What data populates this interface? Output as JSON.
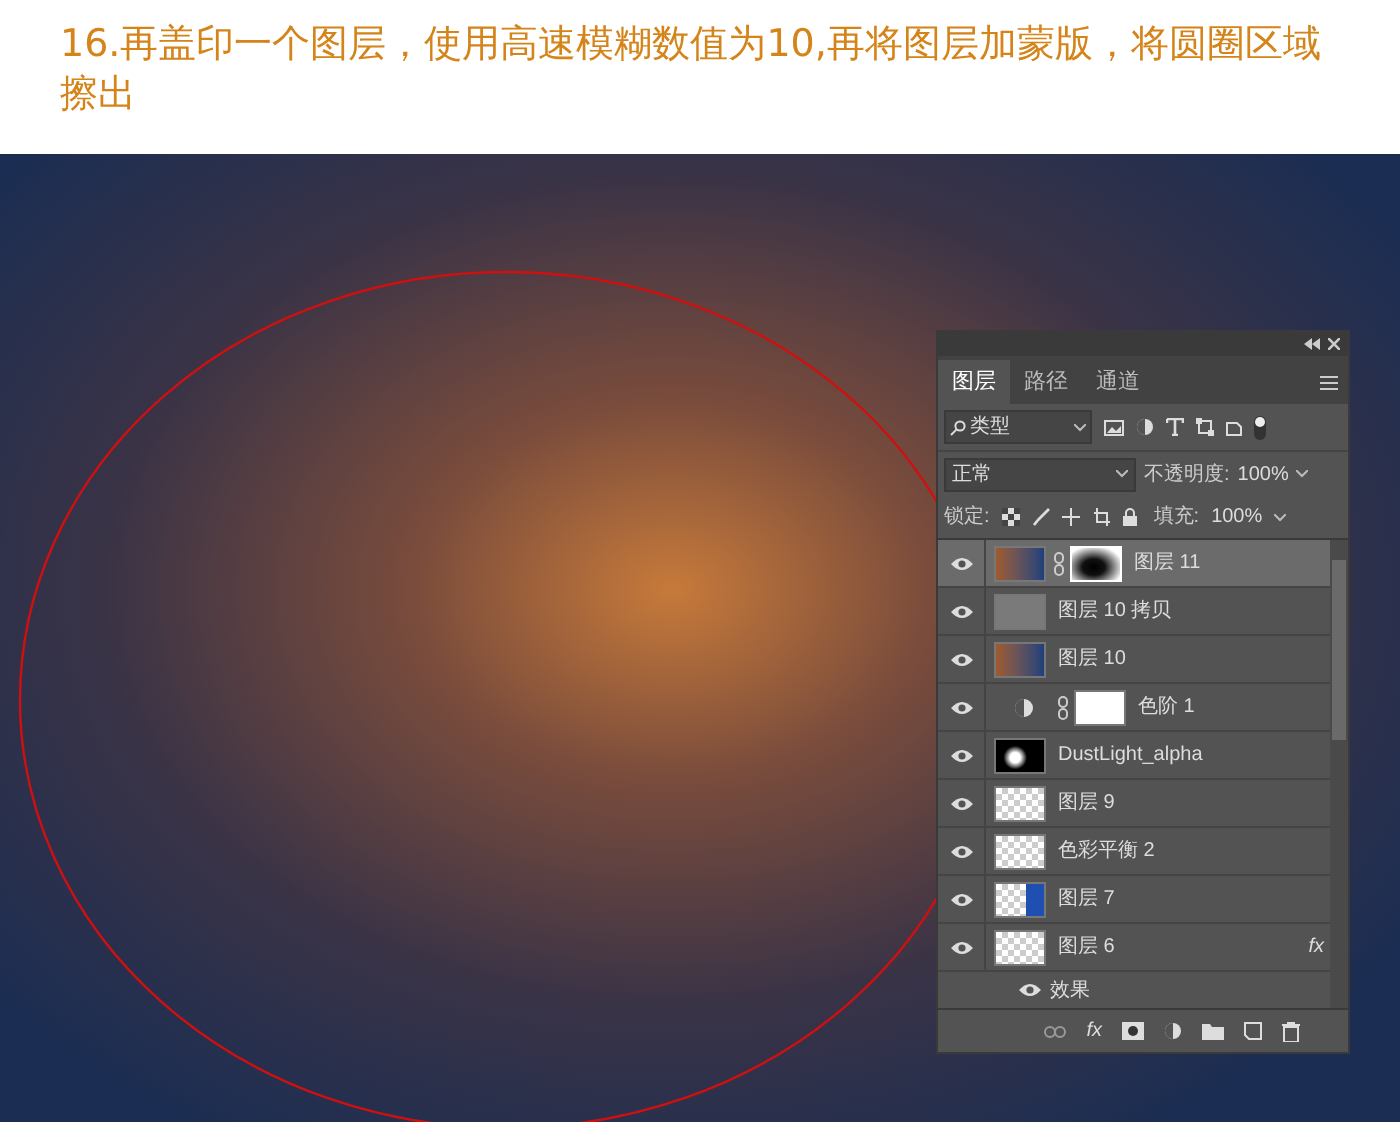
{
  "heading": "16.再盖印一个图层，使用高速模糊数值为10,再将图层加蒙版，将圆圈区域擦出",
  "panel": {
    "tabs": [
      {
        "label": "图层",
        "selected": true
      },
      {
        "label": "路径",
        "selected": false
      },
      {
        "label": "通道",
        "selected": false
      }
    ],
    "filter": "类型",
    "blend_mode": "正常",
    "opacity_label": "不透明度:",
    "opacity": "100%",
    "lock_label": "锁定:",
    "fill_label": "填充:",
    "fill": "100%",
    "layers": [
      {
        "name": "图层 11",
        "kind": "photo",
        "mask": true,
        "selected": true,
        "visible": true
      },
      {
        "name": "图层 10 拷贝",
        "kind": "gray",
        "mask": false,
        "selected": false,
        "visible": true
      },
      {
        "name": "图层 10",
        "kind": "photo",
        "mask": false,
        "selected": false,
        "visible": true
      },
      {
        "name": "色阶 1",
        "kind": "adjustment",
        "mask": true,
        "selected": false,
        "visible": true
      },
      {
        "name": "DustLight_alpha",
        "kind": "dark",
        "mask": false,
        "selected": false,
        "visible": true
      },
      {
        "name": "图层 9",
        "kind": "checker",
        "mask": false,
        "selected": false,
        "visible": true
      },
      {
        "name": "色彩平衡 2",
        "kind": "checker",
        "mask": false,
        "selected": false,
        "visible": true
      },
      {
        "name": "图层 7",
        "kind": "checker-blue",
        "mask": false,
        "selected": false,
        "visible": true
      },
      {
        "name": "图层 6",
        "kind": "checker",
        "mask": false,
        "selected": false,
        "visible": true,
        "fx": "fx",
        "children": [
          {
            "name": "效果",
            "visible": true
          }
        ]
      }
    ],
    "toolbar_fx": "fx"
  }
}
